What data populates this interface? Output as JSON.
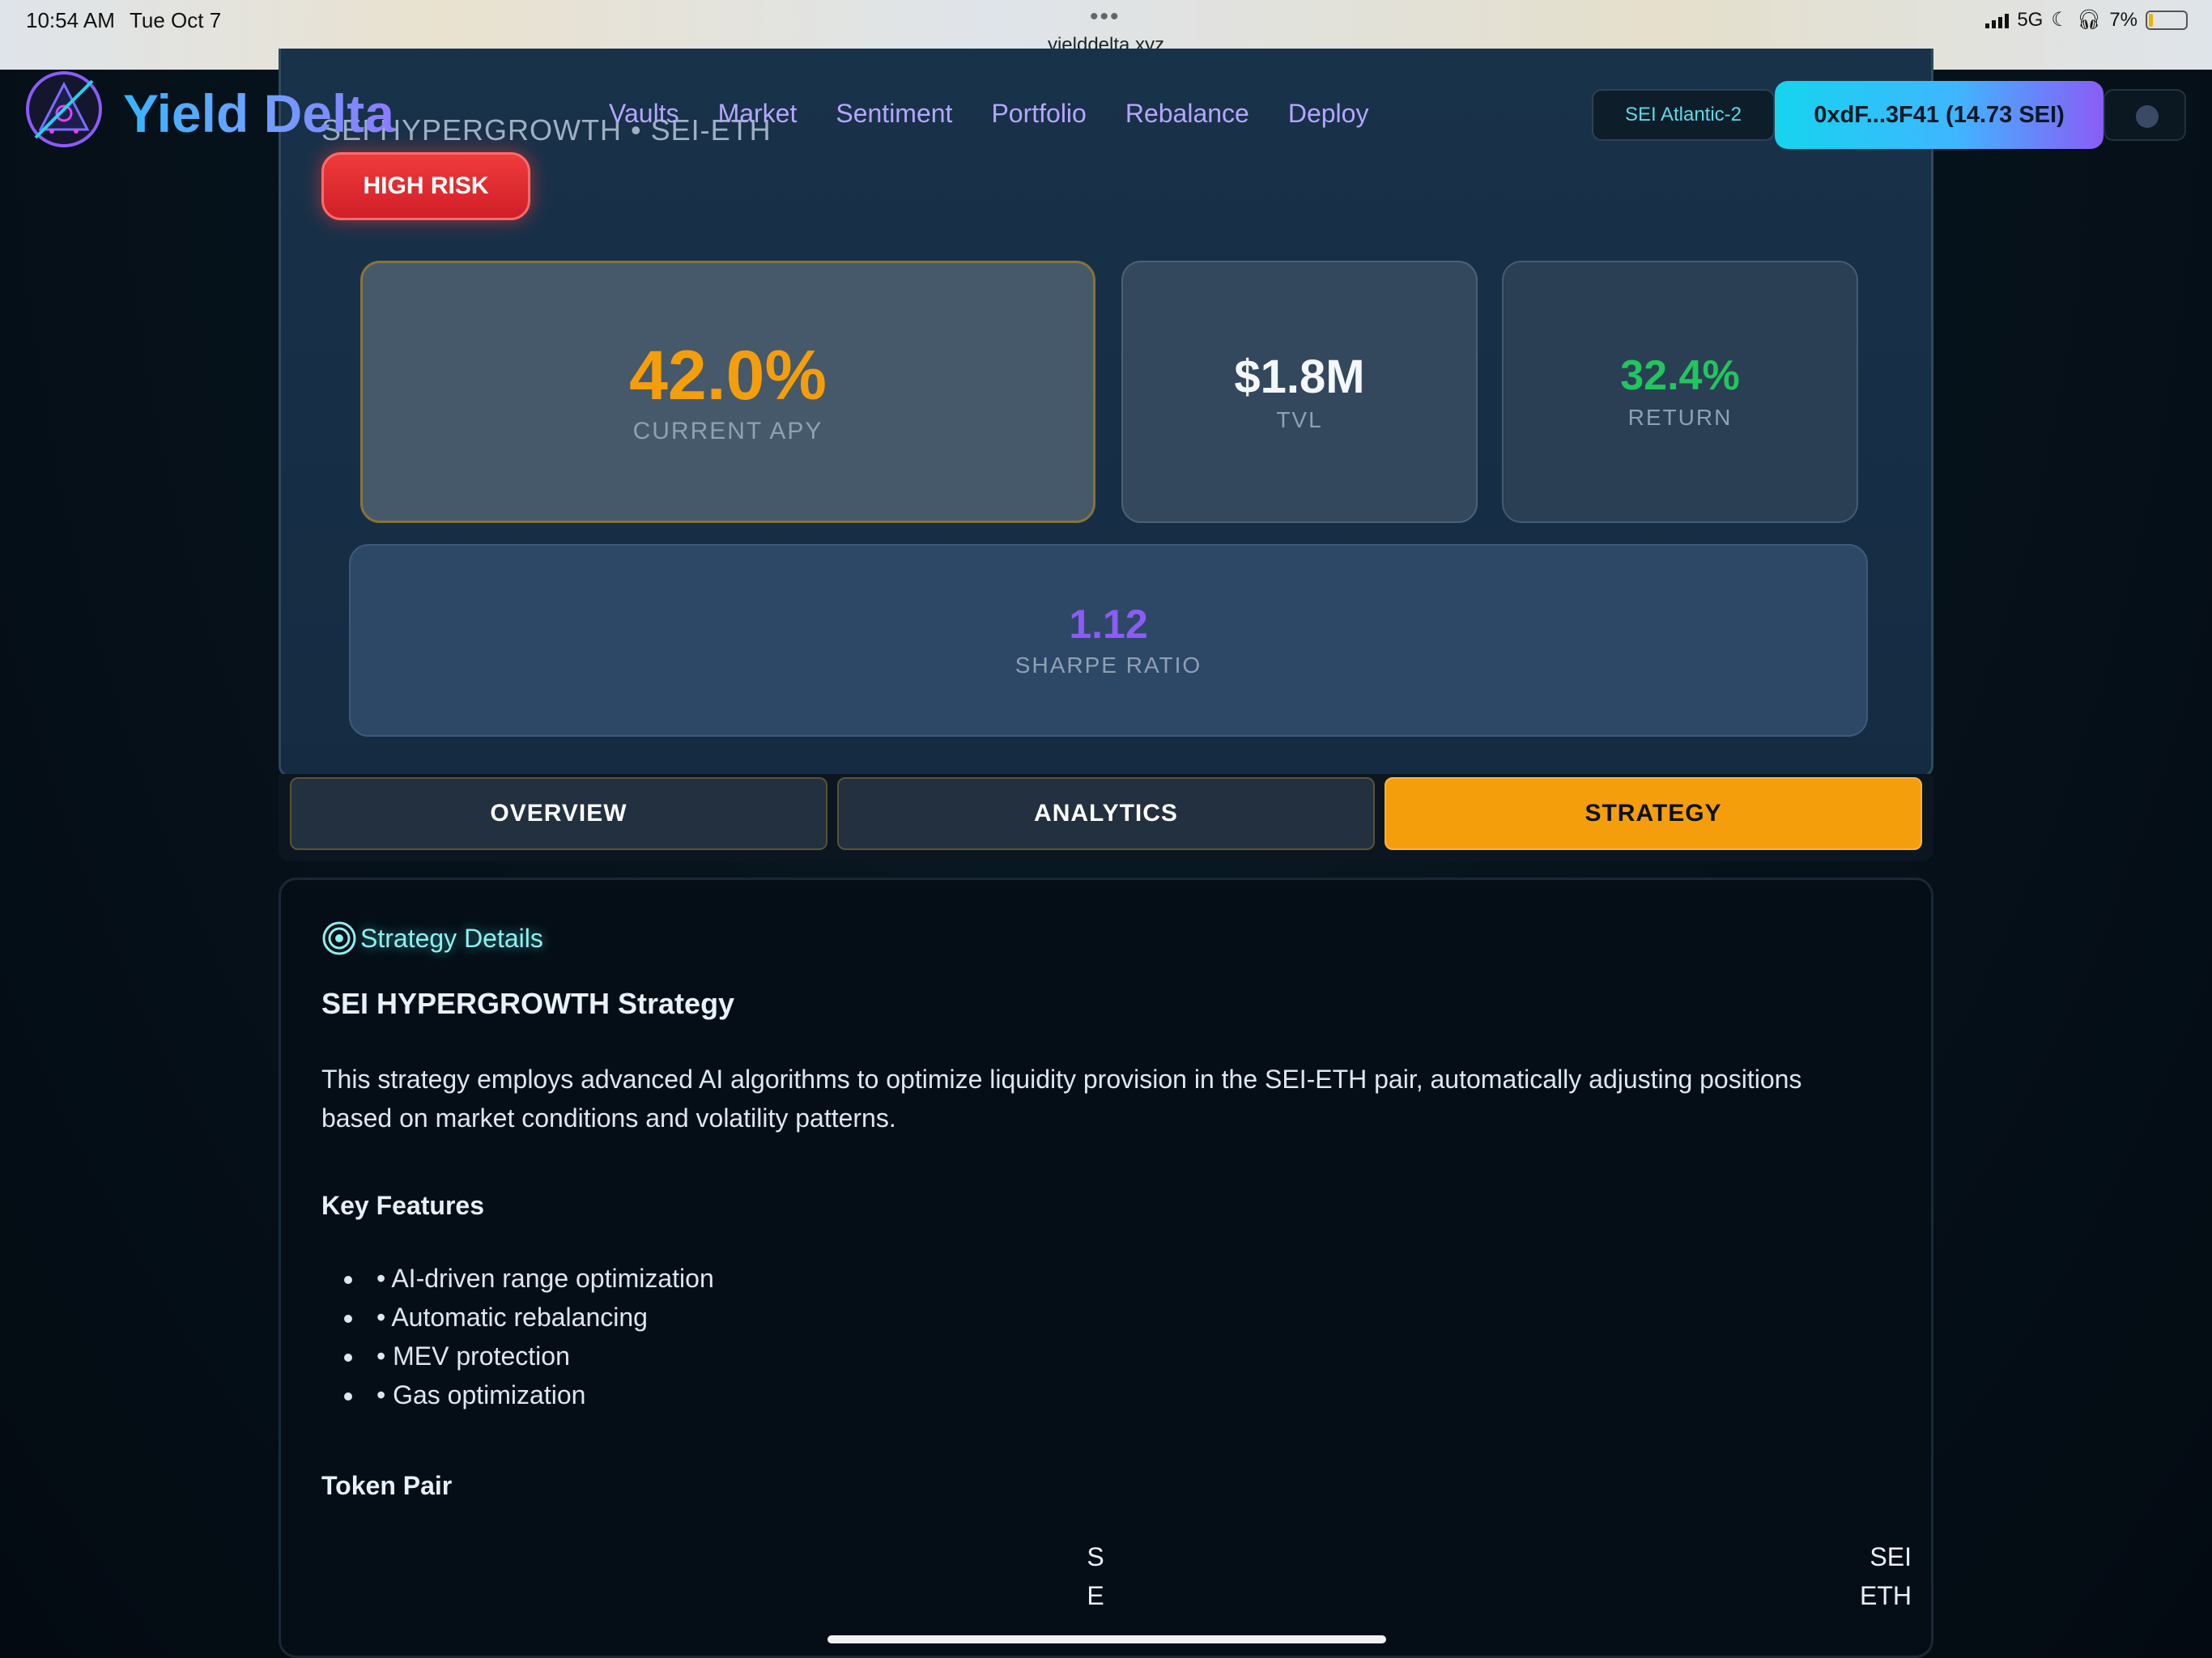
{
  "status_bar": {
    "time": "10:54 AM",
    "date": "Tue Oct 7",
    "url": "yielddelta.xyz",
    "network": "5G",
    "battery": "7%"
  },
  "nav": {
    "brand": "Yield Delta",
    "links": [
      "Vaults",
      "Market",
      "Sentiment",
      "Portfolio",
      "Rebalance",
      "Deploy"
    ],
    "network_label": "SEI Atlantic-2",
    "wallet_label": "0xdF...3F41 (14.73 SEI)"
  },
  "hero": {
    "subtitle": "SEI HYPERGROWTH • SEI-ETH",
    "risk_badge": "HIGH RISK",
    "stats": {
      "apy": {
        "value": "42.0%",
        "label": "CURRENT APY"
      },
      "tvl": {
        "value": "$1.8M",
        "label": "TVL"
      },
      "return": {
        "value": "32.4%",
        "label": "RETURN"
      },
      "sharpe": {
        "value": "1.12",
        "label": "SHARPE RATIO"
      }
    }
  },
  "tabs": [
    {
      "label": "OVERVIEW",
      "active": false
    },
    {
      "label": "ANALYTICS",
      "active": false
    },
    {
      "label": "STRATEGY",
      "active": true
    }
  ],
  "strategy": {
    "tag": "Strategy Details",
    "title": "SEI HYPERGROWTH Strategy",
    "description": "This strategy employs advanced AI algorithms to optimize liquidity provision in the SEI-ETH pair, automatically adjusting positions based on market conditions and volatility patterns.",
    "features_title": "Key Features",
    "features": [
      "• AI-driven range optimization",
      "• Automatic rebalancing",
      "• MEV protection",
      "• Gas optimization"
    ],
    "token_pair_title": "Token Pair",
    "token_left": [
      "S",
      "E"
    ],
    "token_right": [
      "SEI",
      "ETH"
    ]
  },
  "colors": {
    "accent_orange": "#f59e0b",
    "return_green": "#22c55e",
    "sharpe_purple": "#8b5cf6",
    "risk_red": "#ef3b3b"
  },
  "icons": [
    "logo-icon",
    "target-icon",
    "theme-toggle-icon",
    "signal-icon",
    "moon-icon",
    "headphones-icon",
    "battery-icon"
  ]
}
